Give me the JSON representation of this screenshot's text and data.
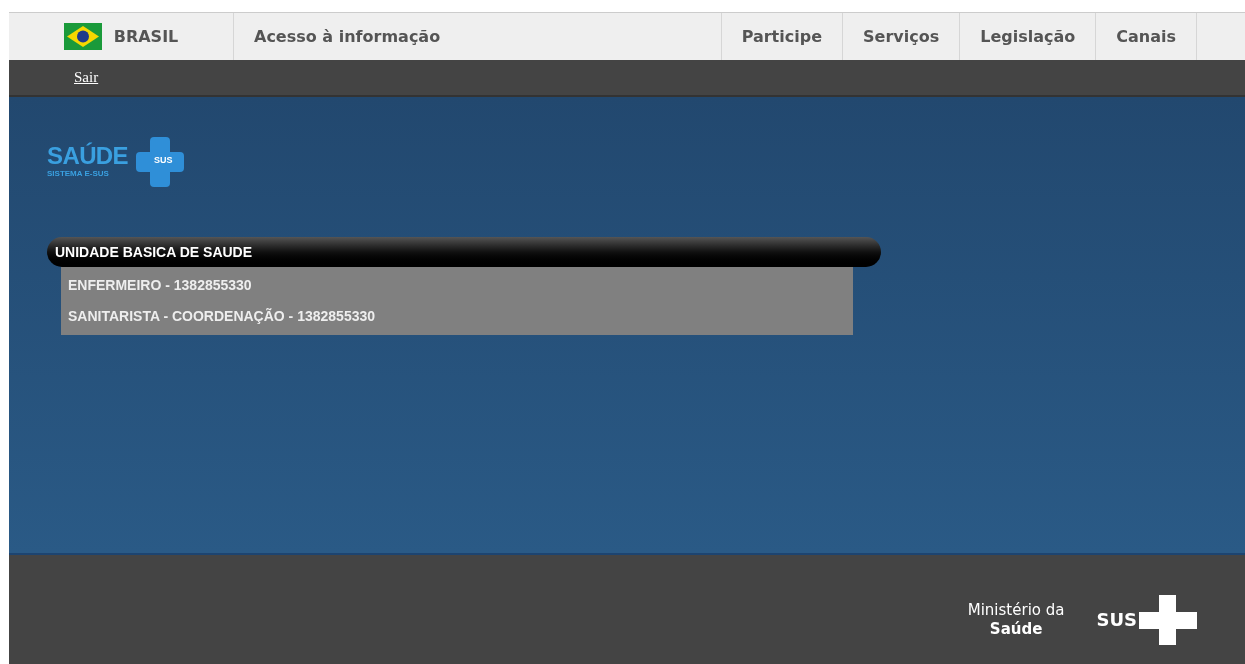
{
  "gov_bar": {
    "country": "BRASIL",
    "access": "Acesso à informação",
    "links": [
      "Participe",
      "Serviços",
      "Legislação",
      "Canais"
    ]
  },
  "user_bar": {
    "logout": "Sair"
  },
  "logo": {
    "title": "SAÚDE",
    "subtitle": "SISTEMA E-SUS",
    "badge": "SUS"
  },
  "unit": {
    "name": "UNIDADE BASICA DE SAUDE",
    "profiles": [
      "ENFERMEIRO - 1382855330",
      "SANITARISTA - COORDENAÇÃO - 1382855330"
    ]
  },
  "footer": {
    "ministry_line1": "Ministério da",
    "ministry_line2": "Saúde",
    "sus": "SUS"
  }
}
